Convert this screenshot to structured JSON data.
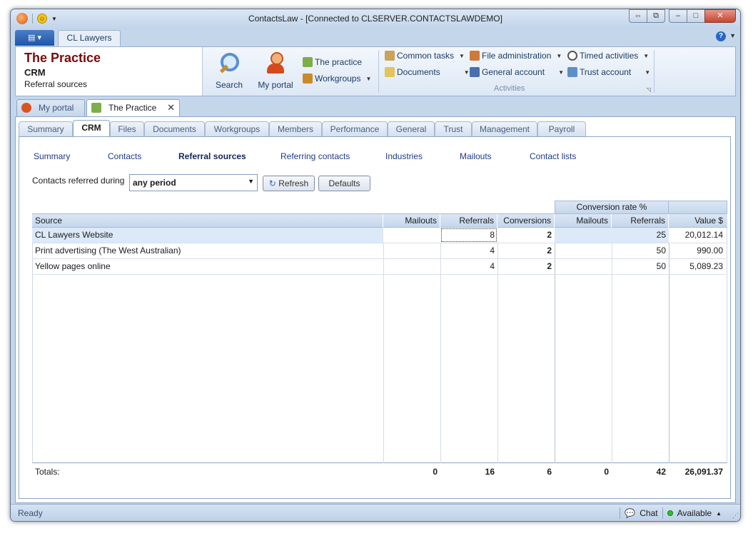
{
  "window": {
    "title": "ContactsLaw - [Connected to CLSERVER.CONTACTSLAWDEMO]"
  },
  "ribbon": {
    "app_tab": "CL Lawyers",
    "context": {
      "title": "The Practice",
      "section": "CRM",
      "page": "Referral sources"
    },
    "search_label": "Search",
    "myportal_label": "My portal",
    "practice_label": "The practice",
    "workgroups_label": "Workgroups",
    "common_tasks_label": "Common tasks",
    "documents_label": "Documents",
    "file_admin_label": "File administration",
    "general_account_label": "General account",
    "timed_activities_label": "Timed activities",
    "trust_account_label": "Trust account",
    "activities_group_label": "Activities"
  },
  "doc_tabs": [
    {
      "label": "My portal"
    },
    {
      "label": "The Practice"
    }
  ],
  "page_tabs": [
    "Summary",
    "CRM",
    "Files",
    "Documents",
    "Workgroups",
    "Members",
    "Performance",
    "General",
    "Trust",
    "Management",
    "Payroll"
  ],
  "sub_nav": [
    "Summary",
    "Contacts",
    "Referral sources",
    "Referring contacts",
    "Industries",
    "Mailouts",
    "Contact lists"
  ],
  "filter": {
    "label": "Contacts referred during",
    "value": "any period",
    "refresh_label": "Refresh",
    "defaults_label": "Defaults"
  },
  "grid": {
    "group_header": "Conversion rate %",
    "columns": [
      "Source",
      "Mailouts",
      "Referrals",
      "Conversions",
      "Mailouts",
      "Referrals",
      "Value $"
    ],
    "rows": [
      {
        "source": "CL Lawyers Website",
        "mailouts": "",
        "referrals": "8",
        "conversions": "2",
        "conv_mailouts": "",
        "conv_referrals": "25",
        "value": "20,012.14"
      },
      {
        "source": "Print advertising (The West Australian)",
        "mailouts": "",
        "referrals": "4",
        "conversions": "2",
        "conv_mailouts": "",
        "conv_referrals": "50",
        "value": "990.00"
      },
      {
        "source": "Yellow pages online",
        "mailouts": "",
        "referrals": "4",
        "conversions": "2",
        "conv_mailouts": "",
        "conv_referrals": "50",
        "value": "5,089.23"
      }
    ],
    "totals": {
      "label": "Totals:",
      "mailouts": "0",
      "referrals": "16",
      "conversions": "6",
      "conv_mailouts": "0",
      "conv_referrals": "42",
      "value": "26,091.37"
    }
  },
  "status": {
    "left": "Ready",
    "chat": "Chat",
    "presence": "Available"
  }
}
